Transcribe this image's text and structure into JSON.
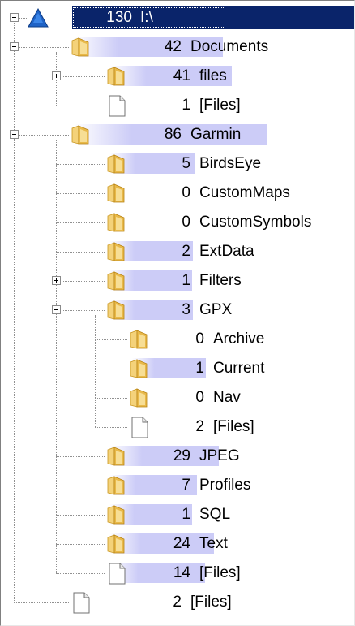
{
  "colors": {
    "selection": "#0a246a",
    "bar": "#ccccf7",
    "folder": "#e8b94a",
    "connector": "#909090"
  },
  "tree": {
    "root": {
      "count": "130",
      "label": "I:\\",
      "icon": "drive-triangle-icon",
      "expanded": true,
      "selected": true
    },
    "items": [
      {
        "level": 1,
        "count": "42",
        "label": "Documents",
        "icon": "folder-icon",
        "expander": "minus",
        "fraction": 0.32
      },
      {
        "level": 2,
        "count": "41",
        "label": "files",
        "icon": "folder-icon",
        "expander": "plus",
        "fraction": 0.32
      },
      {
        "level": 2,
        "count": "1",
        "label": "[Files]",
        "icon": "file-icon",
        "expander": "none",
        "fraction": 0.0
      },
      {
        "level": 1,
        "count": "86",
        "label": "Garmin",
        "icon": "folder-icon",
        "expander": "minus",
        "fraction": 0.66
      },
      {
        "level": 2,
        "count": "5",
        "label": "BirdsEye",
        "icon": "folder-icon",
        "expander": "none",
        "fraction": 0.04
      },
      {
        "level": 2,
        "count": "0",
        "label": "CustomMaps",
        "icon": "folder-icon",
        "expander": "none",
        "fraction": 0.0
      },
      {
        "level": 2,
        "count": "0",
        "label": "CustomSymbols",
        "icon": "folder-icon",
        "expander": "none",
        "fraction": 0.0
      },
      {
        "level": 2,
        "count": "2",
        "label": "ExtData",
        "icon": "folder-icon",
        "expander": "none",
        "fraction": 0.02
      },
      {
        "level": 2,
        "count": "1",
        "label": "Filters",
        "icon": "folder-icon",
        "expander": "plus",
        "fraction": 0.01
      },
      {
        "level": 2,
        "count": "3",
        "label": "GPX",
        "icon": "folder-icon",
        "expander": "minus",
        "fraction": 0.02
      },
      {
        "level": 3,
        "count": "0",
        "label": "Archive",
        "icon": "folder-icon",
        "expander": "none",
        "fraction": 0.0
      },
      {
        "level": 3,
        "count": "1",
        "label": "Current",
        "icon": "folder-icon",
        "expander": "none",
        "fraction": 0.01
      },
      {
        "level": 3,
        "count": "0",
        "label": "Nav",
        "icon": "folder-icon",
        "expander": "none",
        "fraction": 0.0
      },
      {
        "level": 3,
        "count": "2",
        "label": "[Files]",
        "icon": "file-icon",
        "expander": "none",
        "fraction": 0.0
      },
      {
        "level": 2,
        "count": "29",
        "label": "JPEG",
        "icon": "folder-icon",
        "expander": "none",
        "fraction": 0.22
      },
      {
        "level": 2,
        "count": "7",
        "label": "Profiles",
        "icon": "folder-icon",
        "expander": "none",
        "fraction": 0.05
      },
      {
        "level": 2,
        "count": "1",
        "label": "SQL",
        "icon": "folder-icon",
        "expander": "none",
        "fraction": 0.01
      },
      {
        "level": 2,
        "count": "24",
        "label": "Text",
        "icon": "folder-icon",
        "expander": "none",
        "fraction": 0.18
      },
      {
        "level": 2,
        "count": "14",
        "label": "[Files]",
        "icon": "file-icon",
        "expander": "none",
        "fraction": 0.11
      },
      {
        "level": 1,
        "count": "2",
        "label": "[Files]",
        "icon": "file-icon",
        "expander": "none",
        "fraction": 0.0
      }
    ]
  }
}
